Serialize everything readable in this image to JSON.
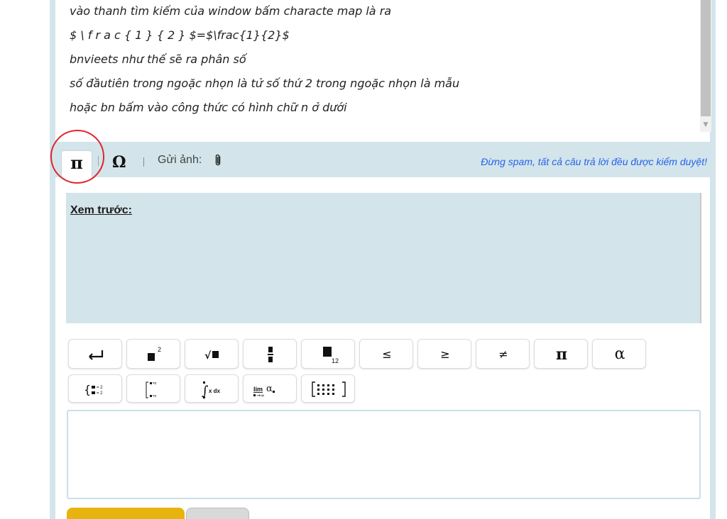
{
  "answer": {
    "lines": [
      "vào thanh tìm kiếm của window bấm characte map là ra",
      "$ \\ f r a c { 1 } { 2 } $=$\\frac{1}{2}$",
      "bnvieets như thế sẽ ra phân số",
      "số đầutiên trong ngoặc nhọn là tử số thứ 2 trong ngoặc nhọn là mẫu",
      "hoặc bn bấm vào công thức có hình chữ n ở dưới"
    ]
  },
  "toolbar": {
    "pi_tab": "π",
    "omega_tab": "Ω",
    "upload_label": "Gửi ảnh:",
    "warning": "Đừng spam, tất cả câu trả lời đều được kiểm duyệt!"
  },
  "preview": {
    "label": "Xem trước:"
  },
  "math_buttons": {
    "leq": "≤",
    "geq": "≥",
    "neq": "≠",
    "pi": "π",
    "alpha": "α"
  },
  "colors": {
    "panel": "#d3e5ea",
    "accent_blue": "#2563eb",
    "annotation_red": "#e22530",
    "submit_yellow": "#e7b40f"
  }
}
